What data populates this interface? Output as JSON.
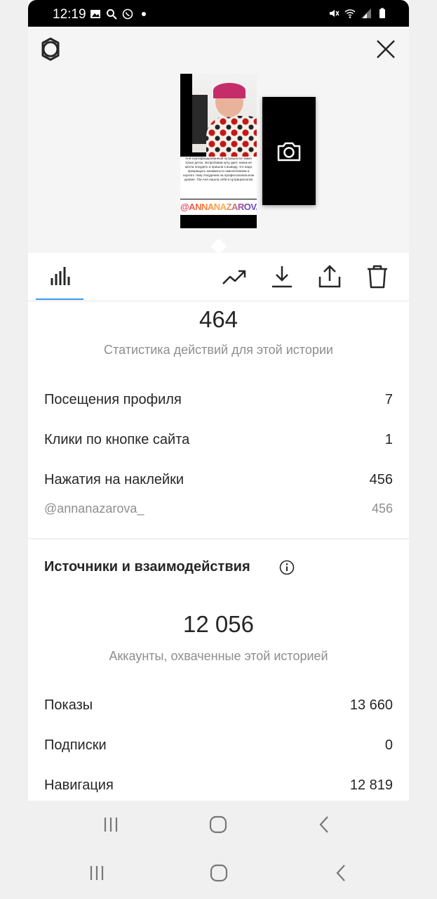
{
  "status_bar": {
    "time": "12:19",
    "left_icons": [
      "image-icon",
      "search-icon",
      "viber-icon",
      "dot-icon"
    ],
    "right_icons": [
      "mute-icon",
      "wifi-icon",
      "signal-icon",
      "battery-icon"
    ]
  },
  "story_preview": {
    "thumbnail_text": "Аня-сертифицированный нутрициолог мама троих деток. Испробовав кучу диет, никак не могла похудеть и пришла к выводу, что надо прекращать заниматься самолечением и изучать тему похудения на профессиональном уровне. Так Аня нашла себя в нутрициологии",
    "thumbnail_handle": "@ANNANAZAROVA_"
  },
  "tabs": [
    {
      "name": "insights",
      "icon": "bar-chart-icon",
      "active": true
    },
    {
      "name": "promote",
      "icon": "trend-up-icon"
    },
    {
      "name": "save",
      "icon": "download-icon"
    },
    {
      "name": "share",
      "icon": "share-icon"
    },
    {
      "name": "delete",
      "icon": "trash-icon"
    }
  ],
  "interactions": {
    "total": "464",
    "caption": "Статистика действий для этой истории",
    "rows": [
      {
        "label": "Посещения профиля",
        "value": "7"
      },
      {
        "label": "Клики по кнопке сайта",
        "value": "1"
      },
      {
        "label": "Нажатия на наклейки",
        "value": "456"
      }
    ],
    "sticker": {
      "label": "@annanazarova_",
      "value": "456"
    }
  },
  "discovery": {
    "title": "Источники и взаимодействия",
    "reach": "12 056",
    "caption": "Аккаунты, охваченные этой историей",
    "rows": [
      {
        "label": "Показы",
        "value": "13 660"
      },
      {
        "label": "Подписки",
        "value": "0"
      },
      {
        "label": "Навигация",
        "value": "12 819"
      }
    ]
  },
  "colors": {
    "accent": "#3897f0",
    "text": "#262626",
    "muted": "#8e8e8e"
  }
}
